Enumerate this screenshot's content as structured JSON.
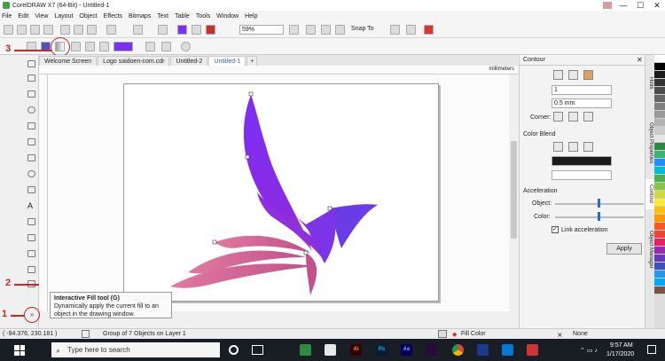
{
  "window": {
    "title": "CorelDRAW X7 (64-Bit) - Untitled-1",
    "min": "—",
    "max": "☐",
    "close": "✕"
  },
  "menu": [
    "File",
    "Edit",
    "View",
    "Layout",
    "Object",
    "Effects",
    "Bitmaps",
    "Text",
    "Table",
    "Tools",
    "Window",
    "Help"
  ],
  "toolbar": {
    "zoom": "59%",
    "snap": "Snap To"
  },
  "tabs": [
    "Welcome Screen",
    "Logo saidoen-com.cdr",
    "Untitled-2",
    "Untitled-1"
  ],
  "ruler": {
    "unit": "millimeters"
  },
  "docker": {
    "title": "Contour",
    "steps": "1",
    "offset": "0.5 mm",
    "corner_label": "Corner:",
    "color_blend": "Color Blend",
    "acceleration": "Acceleration",
    "object_label": "Object:",
    "color_label": "Color:",
    "link": "Link acceleration",
    "apply": "Apply"
  },
  "side_tabs": [
    "Hints",
    "Object Properties",
    "Contour",
    "Object Manager"
  ],
  "tooltip": {
    "title": "Interactive Fill tool (G)",
    "desc": "Dynamically apply the current fill to an object in the drawing window."
  },
  "annotations": [
    "1",
    "2",
    "3"
  ],
  "status": {
    "coords": "( -94.376, 230.181 )",
    "info": "Group of 7 Objects on Layer 1",
    "fill": "Fill Color",
    "outline": "None"
  },
  "taskbar": {
    "search": "Type here to search",
    "time": "9:57 AM",
    "date": "1/17/2020"
  },
  "colors": {
    "purple": "#7b2ff7",
    "magenta": "#c2508a",
    "pink": "#e07aa0",
    "accent": "#1f6ed4",
    "annotation": "#c62828"
  },
  "palette": [
    "#ffffff",
    "#000000",
    "#1a1a1a",
    "#333333",
    "#4d4d4d",
    "#666666",
    "#808080",
    "#999999",
    "#b3b3b3",
    "#cccccc",
    "#e6e6e6",
    "#2d8a3e",
    "#3cb371",
    "#1e90ff",
    "#00bcd4",
    "#4caf50",
    "#8bc34a",
    "#cddc39",
    "#ffeb3b",
    "#ffc107",
    "#ff9800",
    "#ff5722",
    "#f44336",
    "#e91e63",
    "#9c27b0",
    "#673ab7",
    "#3f51b5",
    "#2196f3",
    "#03a9f4",
    "#795548"
  ]
}
